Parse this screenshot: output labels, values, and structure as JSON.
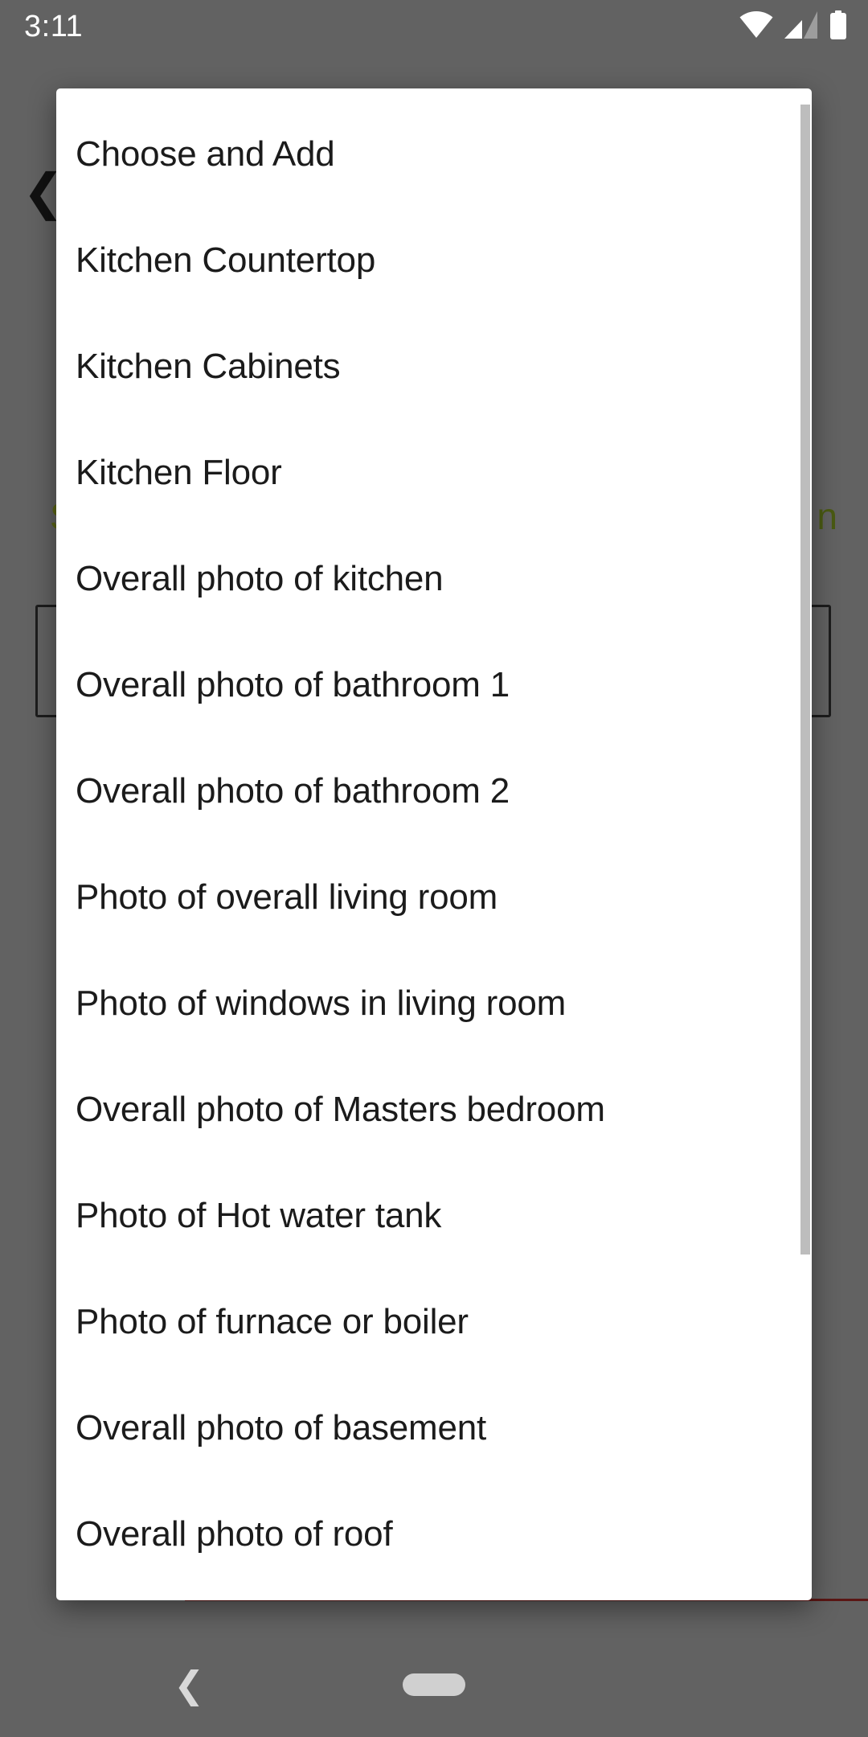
{
  "status_bar": {
    "clock": "3:11",
    "icons": [
      {
        "name": "wifi-icon",
        "label": "wifi"
      },
      {
        "name": "cellular-signal-icon",
        "label": "cellular signal"
      },
      {
        "name": "battery-icon",
        "label": "battery"
      }
    ]
  },
  "background_app": {
    "back_chevron": "❮",
    "title_left_fragment": "S",
    "title_right_fragment": "n",
    "accent_color": "#5a6415"
  },
  "dialog": {
    "items": [
      {
        "label": "Choose and Add"
      },
      {
        "label": "Kitchen Countertop"
      },
      {
        "label": "Kitchen Cabinets"
      },
      {
        "label": "Kitchen Floor"
      },
      {
        "label": "Overall photo of kitchen"
      },
      {
        "label": "Overall photo of bathroom 1"
      },
      {
        "label": "Overall photo of bathroom 2"
      },
      {
        "label": "Photo of overall living room"
      },
      {
        "label": "Photo of windows in living room"
      },
      {
        "label": "Overall photo of Masters bedroom"
      },
      {
        "label": "Photo of Hot water tank"
      },
      {
        "label": "Photo of furnace or boiler"
      },
      {
        "label": "Overall photo of basement"
      },
      {
        "label": "Overall photo of roof"
      }
    ],
    "background_color": "#ffffff",
    "text_color": "#1b1b1b",
    "scrollbar_color": "#bdbdbd"
  },
  "nav_bar": {
    "back_label": "❮",
    "home_label": "home-pill"
  }
}
